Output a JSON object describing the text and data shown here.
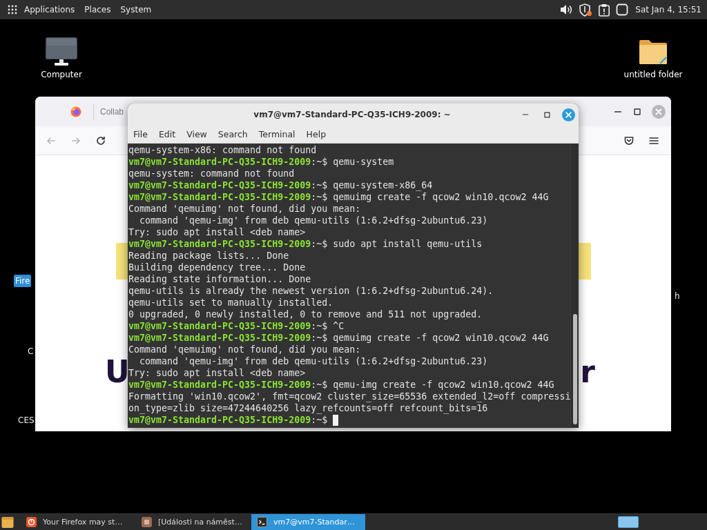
{
  "top_panel": {
    "menus": [
      {
        "label": "Applications",
        "kind": "apps"
      },
      {
        "label": "Places",
        "kind": "plain"
      },
      {
        "label": "System",
        "kind": "plain"
      }
    ],
    "clock": "Sat Jan 4, 15:51"
  },
  "desktop": {
    "icons": [
      {
        "label": "Computer",
        "kind": "computer"
      },
      {
        "label": "untitled folder",
        "kind": "folder"
      }
    ],
    "partial_labels": [
      {
        "label": "Fire",
        "selected": true
      },
      {
        "label": "C",
        "selected": false
      },
      {
        "label": "CES",
        "selected": false
      },
      {
        "label": "h",
        "selected": false
      }
    ]
  },
  "browser_window": {
    "tab": {
      "label": "Collab"
    },
    "page": {
      "heading_left": "U",
      "heading_right": "r"
    }
  },
  "terminal_window": {
    "title": "vm7@vm7-Standard-PC-Q35-ICH9-2009: ~",
    "menu": [
      "File",
      "Edit",
      "View",
      "Search",
      "Terminal",
      "Help"
    ],
    "lines": [
      {
        "kind": "output",
        "text": "qemu-system-x86: command not found",
        "cursor": false
      },
      {
        "kind": "prompt",
        "user": "vm7@vm7-Standard-PC-Q35-ICH9-2009",
        "tail": ":~$",
        "command": "qemu-system",
        "cursor": false
      },
      {
        "kind": "output",
        "text": "qemu-system: command not found",
        "cursor": false
      },
      {
        "kind": "prompt",
        "user": "vm7@vm7-Standard-PC-Q35-ICH9-2009",
        "tail": ":~$",
        "command": "qemu-system-x86_64",
        "cursor": false
      },
      {
        "kind": "prompt",
        "user": "vm7@vm7-Standard-PC-Q35-ICH9-2009",
        "tail": ":~$",
        "command": "qemuimg create -f qcow2 win10.qcow2 44G",
        "cursor": false
      },
      {
        "kind": "output",
        "text": "Command 'qemuimg' not found, did you mean:",
        "cursor": false
      },
      {
        "kind": "output",
        "text": "  command 'qemu-img' from deb qemu-utils (1:6.2+dfsg-2ubuntu6.23)",
        "cursor": false
      },
      {
        "kind": "output",
        "text": "Try: sudo apt install <deb name>",
        "cursor": false
      },
      {
        "kind": "prompt",
        "user": "vm7@vm7-Standard-PC-Q35-ICH9-2009",
        "tail": ":~$",
        "command": "sudo apt install qemu-utils",
        "cursor": false
      },
      {
        "kind": "output",
        "text": "Reading package lists... Done",
        "cursor": false
      },
      {
        "kind": "output",
        "text": "Building dependency tree... Done",
        "cursor": false
      },
      {
        "kind": "output",
        "text": "Reading state information... Done",
        "cursor": false
      },
      {
        "kind": "output",
        "text": "qemu-utils is already the newest version (1:6.2+dfsg-2ubuntu6.24).",
        "cursor": false
      },
      {
        "kind": "output",
        "text": "qemu-utils set to manually installed.",
        "cursor": false
      },
      {
        "kind": "output",
        "text": "0 upgraded, 0 newly installed, 0 to remove and 511 not upgraded.",
        "cursor": false
      },
      {
        "kind": "prompt",
        "user": "vm7@vm7-Standard-PC-Q35-ICH9-2009",
        "tail": ":~$",
        "command": "^C",
        "cursor": false
      },
      {
        "kind": "prompt",
        "user": "vm7@vm7-Standard-PC-Q35-ICH9-2009",
        "tail": ":~$",
        "command": "qemuimg create -f qcow2 win10.qcow2 44G",
        "cursor": false
      },
      {
        "kind": "output",
        "text": "Command 'qemuimg' not found, did you mean:",
        "cursor": false
      },
      {
        "kind": "output",
        "text": "  command 'qemu-img' from deb qemu-utils (1:6.2+dfsg-2ubuntu6.23)",
        "cursor": false
      },
      {
        "kind": "output",
        "text": "Try: sudo apt install <deb name>",
        "cursor": false
      },
      {
        "kind": "prompt",
        "user": "vm7@vm7-Standard-PC-Q35-ICH9-2009",
        "tail": ":~$",
        "command": "qemu-img create -f qcow2 win10.qcow2 44G",
        "cursor": false
      },
      {
        "kind": "output",
        "text": "Formatting 'win10.qcow2', fmt=qcow2 cluster_size=65536 extended_l2=off compressi",
        "cursor": false
      },
      {
        "kind": "output",
        "text": "on_type=zlib size=47244640256 lazy_refcounts=off refcount_bits=16",
        "cursor": false
      },
      {
        "kind": "prompt",
        "user": "vm7@vm7-Standard-PC-Q35-ICH9-2009",
        "tail": ":~$",
        "cursor": true
      }
    ]
  },
  "taskbar": {
    "tasks": [
      {
        "label": "Your Firefox may st…",
        "kind": "browser",
        "selected": false
      },
      {
        "label": "[Události na náměst…",
        "kind": "document",
        "selected": false
      },
      {
        "label": "vm7@vm7-Standar…",
        "kind": "terminal",
        "selected": true
      }
    ]
  }
}
